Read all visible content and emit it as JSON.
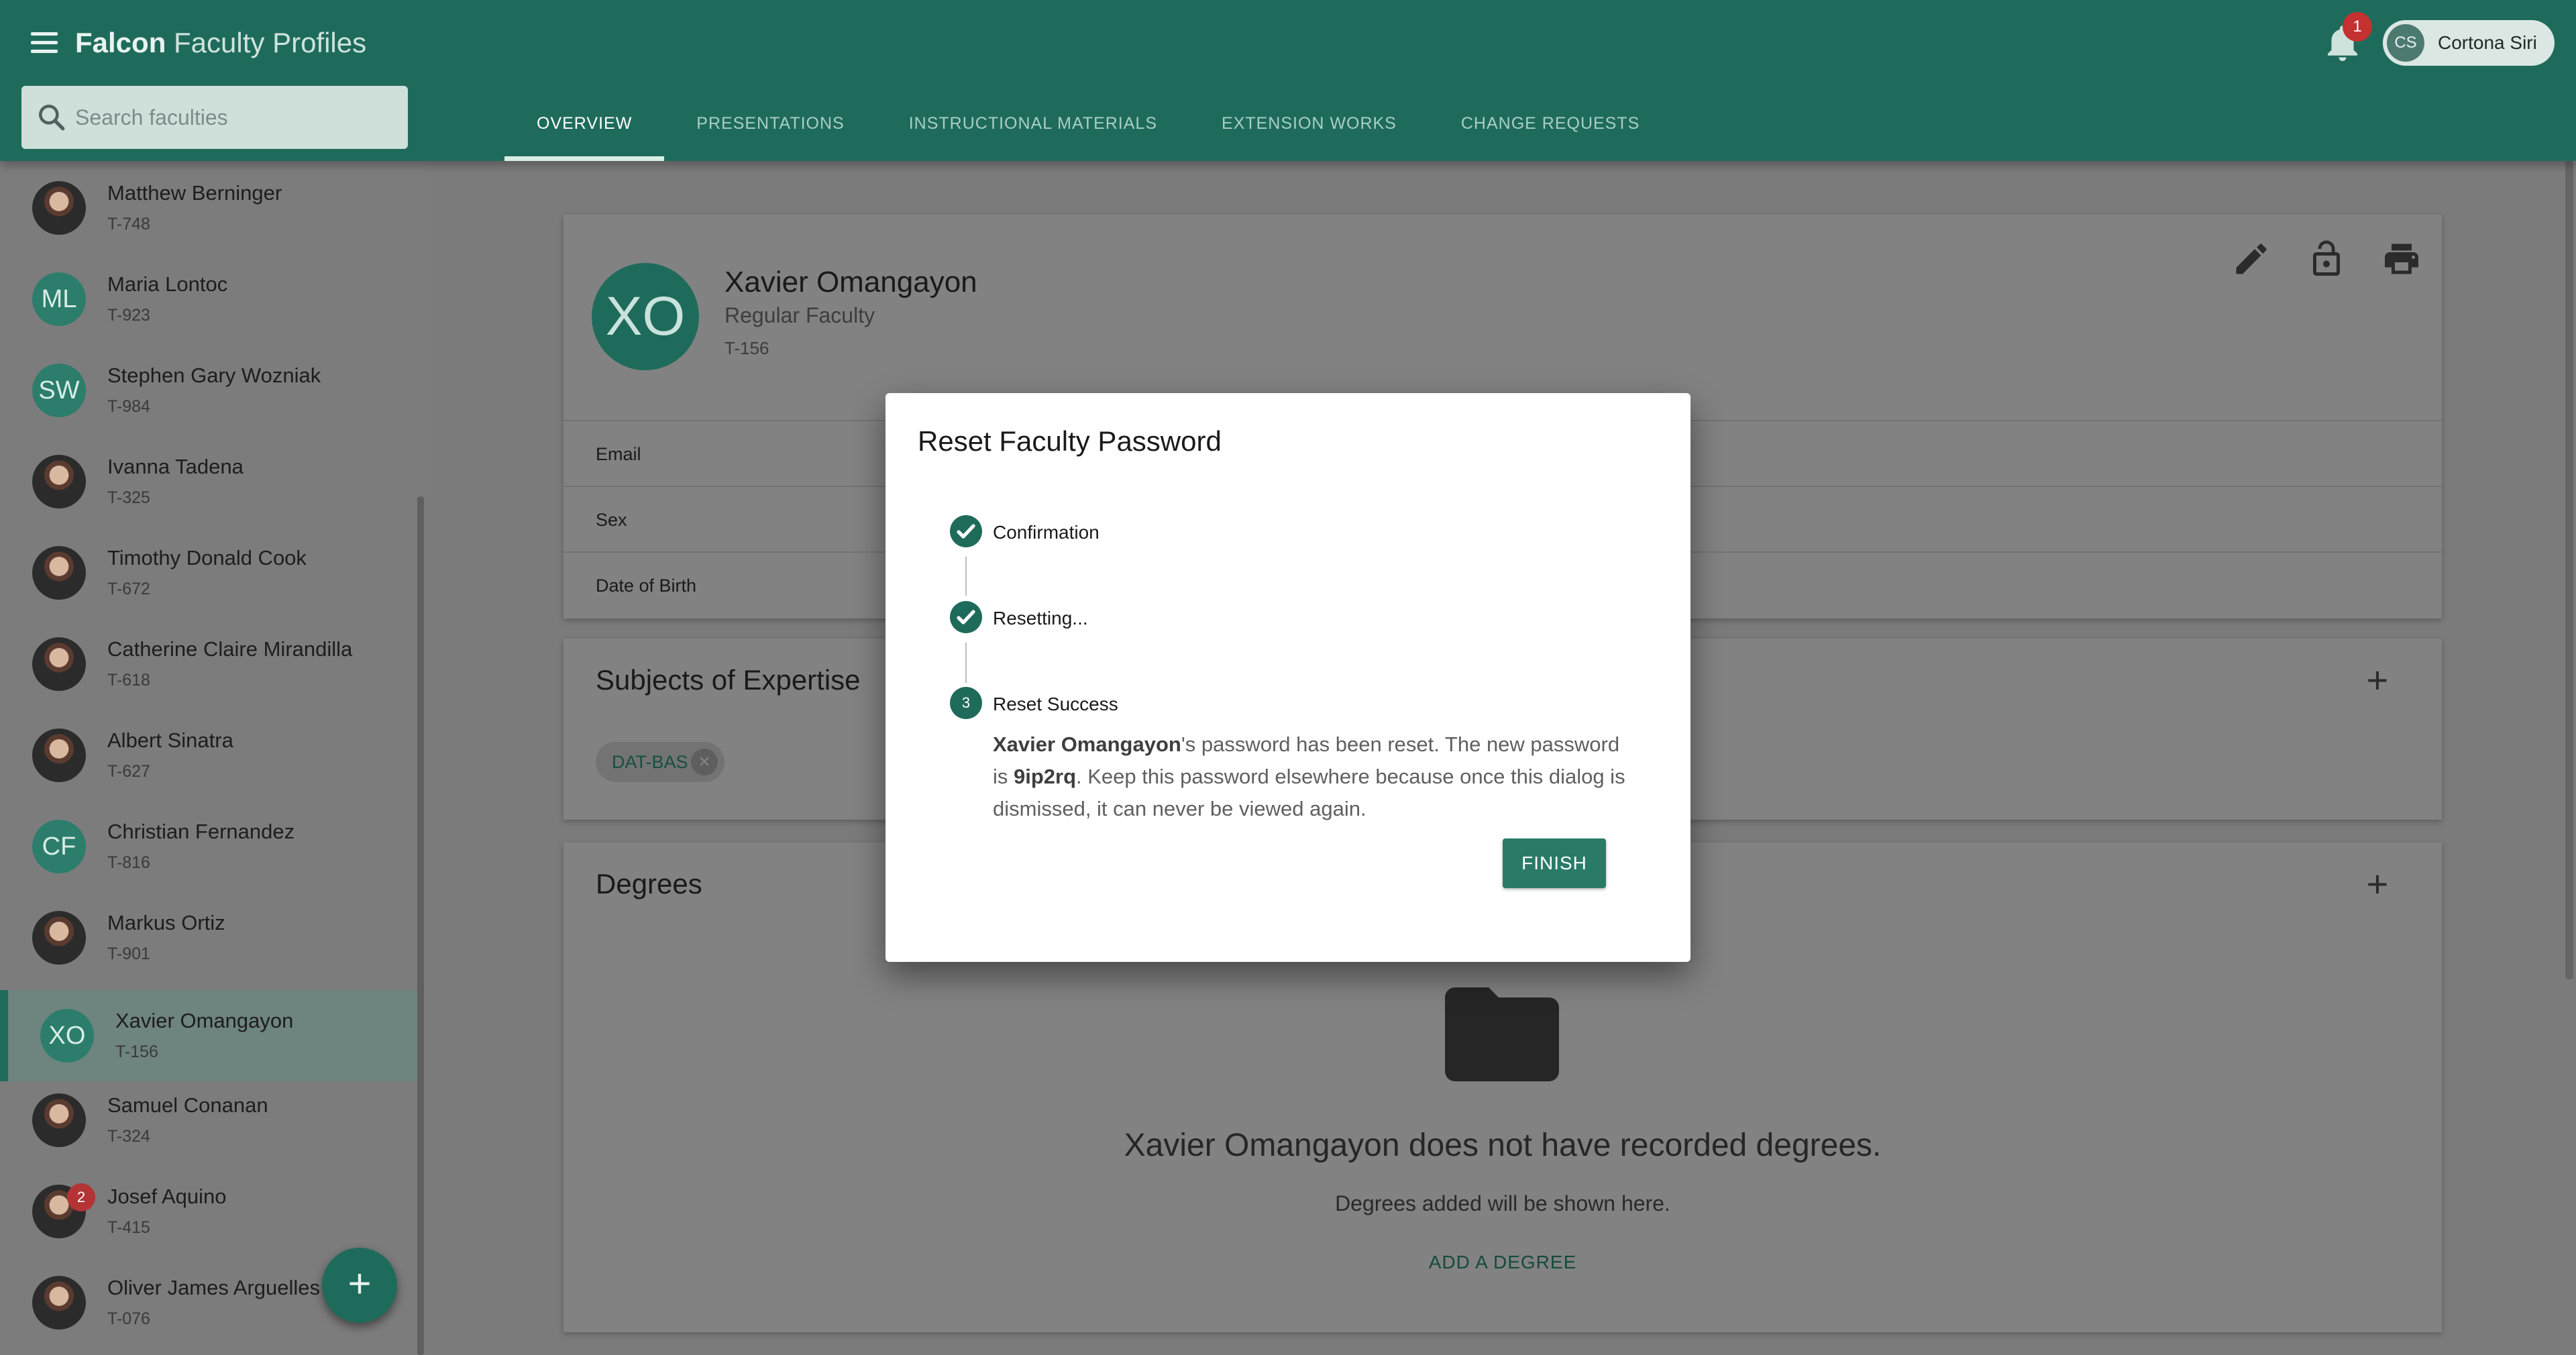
{
  "app": {
    "brand_bold": "Falcon",
    "brand_rest": " Faculty Profiles",
    "search_placeholder": "Search faculties",
    "tabs": [
      "OVERVIEW",
      "PRESENTATIONS",
      "INSTRUCTIONAL MATERIALS",
      "EXTENSION WORKS",
      "CHANGE REQUESTS"
    ],
    "active_tab": "OVERVIEW",
    "notification_count": "1",
    "user": {
      "initials": "CS",
      "name": "Cortona Siri"
    },
    "accent_color": "#1f6b5b"
  },
  "sidebar": {
    "faculties": [
      {
        "name": "Matthew Berninger",
        "id": "T-748",
        "avatar": "photo"
      },
      {
        "name": "Maria Lontoc",
        "id": "T-923",
        "avatar": "initials",
        "initials": "ML"
      },
      {
        "name": "Stephen Gary Wozniak",
        "id": "T-984",
        "avatar": "initials",
        "initials": "SW"
      },
      {
        "name": "Ivanna Tadena",
        "id": "T-325",
        "avatar": "photo"
      },
      {
        "name": "Timothy Donald Cook",
        "id": "T-672",
        "avatar": "photo"
      },
      {
        "name": "Catherine Claire Mirandilla",
        "id": "T-618",
        "avatar": "photo"
      },
      {
        "name": "Albert Sinatra",
        "id": "T-627",
        "avatar": "photo"
      },
      {
        "name": "Christian Fernandez",
        "id": "T-816",
        "avatar": "initials",
        "initials": "CF"
      },
      {
        "name": "Markus Ortiz",
        "id": "T-901",
        "avatar": "photo"
      },
      {
        "name": "Xavier Omangayon",
        "id": "T-156",
        "avatar": "initials",
        "initials": "XO",
        "selected": true
      },
      {
        "name": "Samuel Conanan",
        "id": "T-324",
        "avatar": "photo"
      },
      {
        "name": "Josef Aquino",
        "id": "T-415",
        "avatar": "photo",
        "badge": "2"
      },
      {
        "name": "Oliver James Arguelles",
        "id": "T-076",
        "avatar": "photo"
      }
    ],
    "fab_label": "+"
  },
  "profile": {
    "initials": "XO",
    "name": "Xavier Omangayon",
    "type": "Regular Faculty",
    "id": "T-156",
    "fields": [
      "Email",
      "Sex",
      "Date of Birth"
    ],
    "icons": [
      "edit-icon",
      "lock-icon",
      "print-icon"
    ]
  },
  "expertise": {
    "title": "Subjects of Expertise",
    "chips": [
      "DAT-BAS"
    ]
  },
  "degrees": {
    "title": "Degrees",
    "empty_title": "Xavier Omangayon does not have recorded degrees.",
    "empty_subtitle": "Degrees added will be shown here.",
    "add_link": "ADD A DEGREE"
  },
  "dialog": {
    "title": "Reset Faculty Password",
    "steps": [
      {
        "label": "Confirmation",
        "state": "done"
      },
      {
        "label": "Resetting...",
        "state": "done"
      },
      {
        "label": "Reset Success",
        "state": "active",
        "number": "3"
      }
    ],
    "message": {
      "name": "Xavier Omangayon",
      "part1": "'s password has been reset. The new password is ",
      "password": "9ip2rq",
      "part2": ". Keep this password elsewhere because once this dialog is dismissed, it can never be viewed again."
    },
    "finish_label": "FINISH"
  }
}
